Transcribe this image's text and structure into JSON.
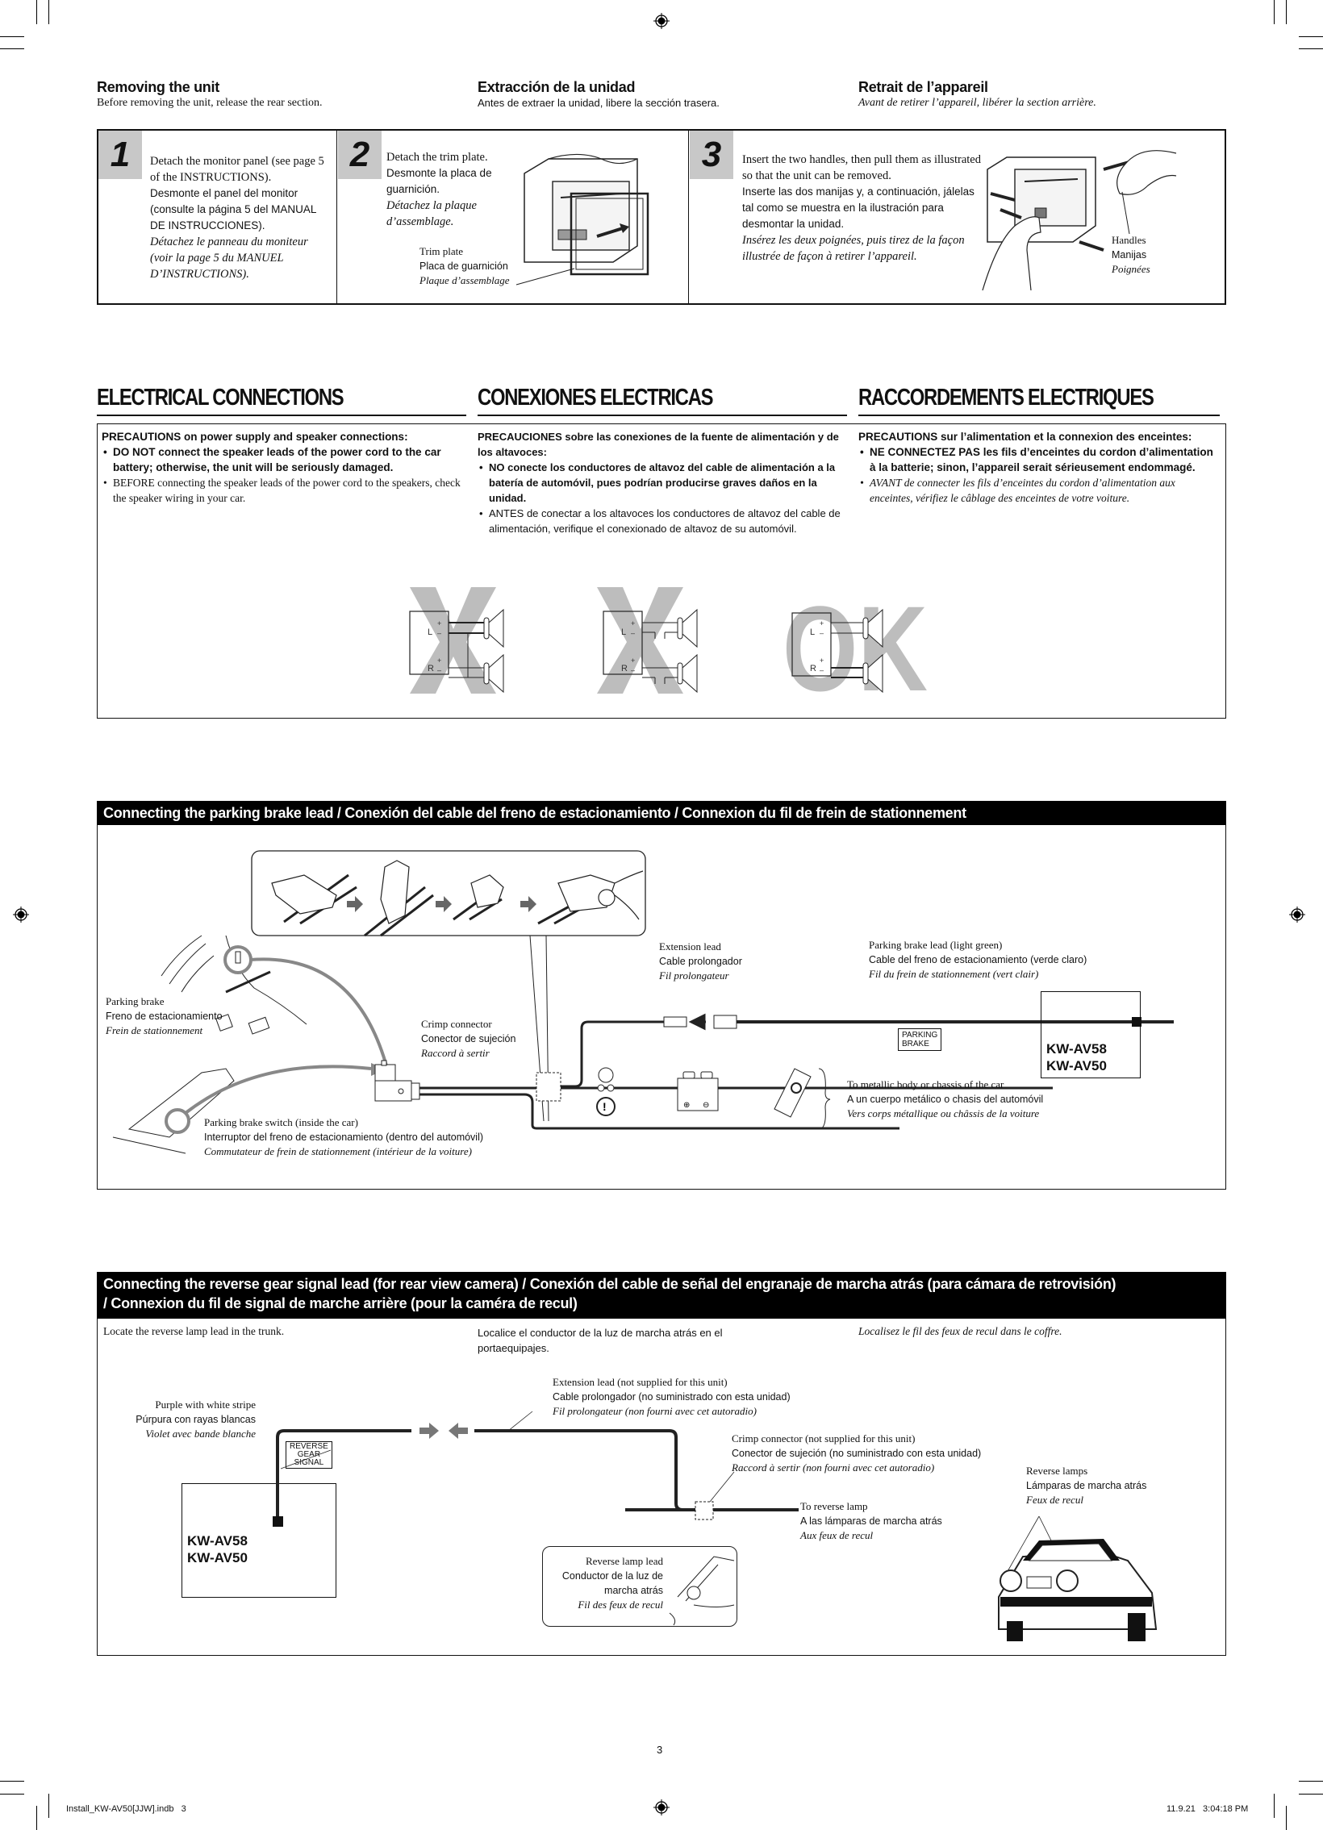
{
  "removing": {
    "columns": [
      {
        "title": "Removing the unit",
        "subtitle": "Before removing the unit, release the rear section."
      },
      {
        "title": "Extracción de la unidad",
        "subtitle": "Antes de extraer la unidad, libere la sección trasera."
      },
      {
        "title": "Retrait de l’appareil",
        "subtitle": "Avant de retirer l’appareil, libérer la section arrière."
      }
    ],
    "steps": [
      {
        "number": "1",
        "en": "Detach the monitor panel (see page 5 of the INSTRUCTIONS).",
        "es": "Desmonte el panel del monitor (consulte la página 5 del MANUAL DE INSTRUCCIONES).",
        "fr": "Détachez le panneau du moniteur (voir la page 5 du MANUEL D’INSTRUCTIONS)."
      },
      {
        "number": "2",
        "en": "Detach the trim plate.",
        "es": "Desmonte la placa de guarnición.",
        "fr": "Détachez la plaque d’assemblage.",
        "callout": {
          "en": "Trim plate",
          "es": "Placa de guarnición",
          "fr": "Plaque d’assemblage"
        }
      },
      {
        "number": "3",
        "en": "Insert the two handles, then pull them as illustrated so that the unit can be removed.",
        "es": "Inserte las dos manijas y, a continuación, jálelas tal como se muestra en la ilustración para desmontar la unidad.",
        "fr": "Insérez les deux poignées, puis tirez de la façon illustrée de façon à retirer l’appareil.",
        "callout": {
          "en": "Handles",
          "es": "Manijas",
          "fr": "Poignées"
        }
      }
    ]
  },
  "electrical": {
    "headings": [
      "ELECTRICAL CONNECTIONS",
      "CONEXIONES ELECTRICAS",
      "RACCORDEMENTS ELECTRIQUES"
    ],
    "precautions": [
      {
        "lead": "PRECAUTIONS on power supply and speaker connections:",
        "bullets": [
          {
            "text": "DO NOT connect the speaker leads of the power cord to the car battery; otherwise, the unit will be seriously damaged.",
            "bold": true
          },
          {
            "text": "BEFORE connecting the speaker leads of the power cord to the speakers, check the speaker wiring in your car.",
            "bold": false
          }
        ]
      },
      {
        "lead": "PRECAUCIONES sobre las conexiones de la fuente de alimentación y de los altavoces:",
        "bullets": [
          {
            "text": "NO conecte los conductores de altavoz del cable de alimentación a la batería de automóvil, pues podrían producirse graves daños en la unidad.",
            "bold": true
          },
          {
            "text": "ANTES de conectar a los altavoces los conductores de altavoz del cable de alimentación, verifique el conexionado de altavoz de su automóvil.",
            "bold": false
          }
        ]
      },
      {
        "lead": "PRECAUTIONS sur l’alimentation et la connexion des enceintes:",
        "bullets": [
          {
            "text": "NE CONNECTEZ PAS les fils d’enceintes du cordon d’alimentation à la batterie; sinon, l’appareil serait sérieusement endommagé.",
            "bold": true
          },
          {
            "text": "AVANT de connecter les fils d’enceintes du cordon d’alimentation aux enceintes, vérifiez le câblage des enceintes de votre voiture.",
            "bold": false,
            "italic": true
          }
        ]
      }
    ],
    "diagrams": {
      "channels": [
        "L",
        "R"
      ],
      "plus": "+",
      "minus": "–",
      "ok_label": "OK",
      "states": [
        "wrong",
        "wrong",
        "ok"
      ]
    }
  },
  "parking": {
    "header": "Connecting the parking brake lead / Conexión del cable del freno de estacionamiento / Connexion du fil de frein de stationnement",
    "parking_brake": {
      "en": "Parking brake",
      "es": "Freno de estacionamiento",
      "fr": "Frein de stationnement"
    },
    "switch": {
      "en": "Parking brake switch (inside the car)",
      "es": "Interruptor del freno de estacionamiento (dentro del automóvil)",
      "fr": "Commutateur de frein de stationnement (intérieur de la voiture)"
    },
    "crimp": {
      "en": "Crimp connector",
      "es": "Conector de sujeción",
      "fr": "Raccord à sertir"
    },
    "extension": {
      "en": "Extension lead",
      "es": "Cable prolongador",
      "fr": "Fil prolongateur"
    },
    "lead": {
      "en": "Parking brake lead (light green)",
      "es": "Cable del freno de estacionamiento (verde claro)",
      "fr": "Fil du frein de stationnement (vert clair)"
    },
    "tag": [
      "PARKING",
      "BRAKE"
    ],
    "models": [
      "KW-AV58",
      "KW-AV50"
    ],
    "ground": {
      "en": "To metallic body or chassis of the car",
      "es": "A un cuerpo metálico o chasis del automóvil",
      "fr": "Vers corps métallique ou châssis de la voiture"
    }
  },
  "reverse": {
    "header_line1": "Connecting the reverse gear signal lead (for rear view camera) / Conexión del cable de señal del engranaje de marcha atrás (para cámara de retrovisión)",
    "header_line2": "/ Connexion du fil de signal de marche arrière (pour la caméra de recul)",
    "locate": {
      "en": "Locate the reverse lamp lead in the trunk.",
      "es": "Localice el conductor de la luz de marcha atrás en el portaequipajes.",
      "fr": "Localisez le fil des feux de recul dans le coffre."
    },
    "wire_color": {
      "en": "Purple with white stripe",
      "es": "Púrpura con rayas blancas",
      "fr": "Violet avec bande blanche"
    },
    "tag": [
      "REVERSE",
      "GEAR",
      "SIGNAL"
    ],
    "models": [
      "KW-AV58",
      "KW-AV50"
    ],
    "extension": {
      "en": "Extension lead (not supplied for this unit)",
      "es": "Cable prolongador (no suministrado con esta unidad)",
      "fr": "Fil prolongateur (non fourni avec cet autoradio)"
    },
    "crimp": {
      "en": "Crimp connector (not supplied for this unit)",
      "es": "Conector de sujeción (no suministrado con esta unidad)",
      "fr": "Raccord à sertir (non fourni avec cet autoradio)"
    },
    "to_lamp": {
      "en": "To reverse lamp",
      "es": "A las lámparas de marcha atrás",
      "fr": "Aux feux de recul"
    },
    "lamp_lead": {
      "en": "Reverse lamp lead",
      "es1": "Conductor de la luz de",
      "es2": "marcha atrás",
      "fr": "Fil des feux de recul"
    },
    "lamps": {
      "en": "Reverse lamps",
      "es": "Lámparas de marcha atrás",
      "fr": "Feux de recul"
    }
  },
  "footer": {
    "page_number": "3",
    "file": "Install_KW-AV50[JJW].indb   3",
    "timestamp": "11.9.21   3:04:18 PM"
  }
}
